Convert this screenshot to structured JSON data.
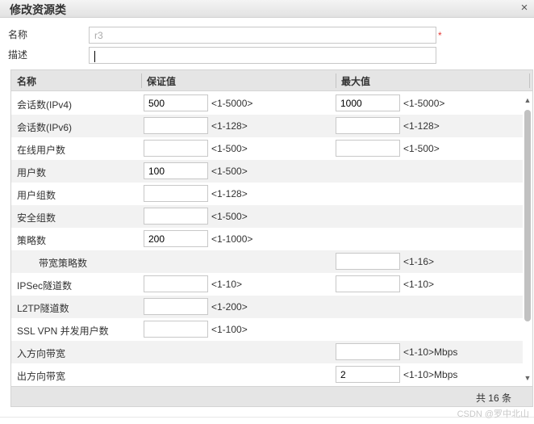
{
  "dialog": {
    "title": "修改资源类",
    "close_symbol": "×"
  },
  "form": {
    "name_label": "名称",
    "name_value": "r3",
    "required_mark": "*",
    "desc_label": "描述",
    "desc_value": ""
  },
  "table": {
    "headers": {
      "name": "名称",
      "guaranteed": "保证值",
      "max": "最大值"
    },
    "rows": [
      {
        "name": "会话数(IPv4)",
        "g_val": "500",
        "g_range": "<1-5000>",
        "m_val": "1000",
        "m_range": "<1-5000>"
      },
      {
        "name": "会话数(IPv6)",
        "g_val": "",
        "g_range": "<1-128>",
        "m_val": "",
        "m_range": "<1-128>"
      },
      {
        "name": "在线用户数",
        "g_val": "",
        "g_range": "<1-500>",
        "m_val": "",
        "m_range": "<1-500>"
      },
      {
        "name": "用户数",
        "g_val": "100",
        "g_range": "<1-500>"
      },
      {
        "name": "用户组数",
        "g_val": "",
        "g_range": "<1-128>"
      },
      {
        "name": "安全组数",
        "g_val": "",
        "g_range": "<1-500>"
      },
      {
        "name": "策略数",
        "g_val": "200",
        "g_range": "<1-1000>"
      },
      {
        "name": "带宽策略数",
        "indent": true,
        "m_val": "",
        "m_range": "<1-16>"
      },
      {
        "name": "IPSec隧道数",
        "g_val": "",
        "g_range": "<1-10>",
        "m_val": "",
        "m_range": "<1-10>"
      },
      {
        "name": "L2TP隧道数",
        "g_val": "",
        "g_range": "<1-200>"
      },
      {
        "name": "SSL VPN 并发用户数",
        "g_val": "",
        "g_range": "<1-100>"
      },
      {
        "name": "入方向带宽",
        "m_val": "",
        "m_range": "<1-10>Mbps"
      },
      {
        "name": "出方向带宽",
        "m_val": "2",
        "m_range": "<1-10>Mbps"
      }
    ],
    "footer_total": "共 16 条"
  },
  "watermark": "CSDN @罗中北山",
  "icons": {
    "close": "close-icon",
    "scroll_up": "arrow-up-icon",
    "scroll_down": "arrow-down-icon"
  }
}
